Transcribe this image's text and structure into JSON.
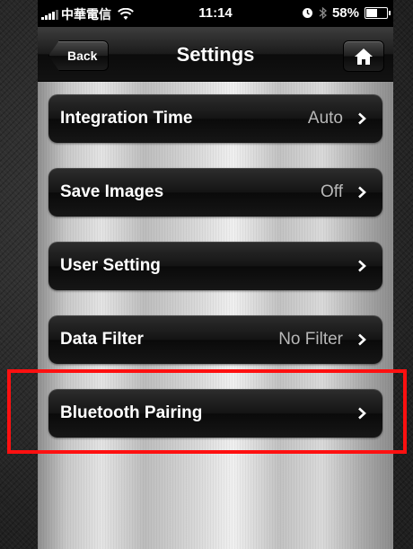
{
  "status_bar": {
    "carrier": "中華電信",
    "time": "11:14",
    "battery": "58%",
    "battery_level": 0.58,
    "icons": [
      "signal-icon",
      "wifi-icon",
      "alarm-icon",
      "bluetooth-icon",
      "battery-icon"
    ]
  },
  "nav": {
    "back_label": "Back",
    "title": "Settings",
    "home_icon": "home-icon"
  },
  "settings": [
    {
      "label": "Integration Time",
      "value": "Auto"
    },
    {
      "label": "Save Images",
      "value": "Off"
    },
    {
      "label": "User Setting",
      "value": ""
    },
    {
      "label": "Data Filter",
      "value": "No Filter"
    },
    {
      "label": "Bluetooth Pairing",
      "value": ""
    }
  ],
  "highlight": {
    "target": "Bluetooth Pairing",
    "color": "#ff1010"
  },
  "colors": {
    "nav_bar": "#1b1b1b",
    "row_background": "#141414",
    "row_label": "#ffffff",
    "row_value": "#b8b8b8"
  }
}
